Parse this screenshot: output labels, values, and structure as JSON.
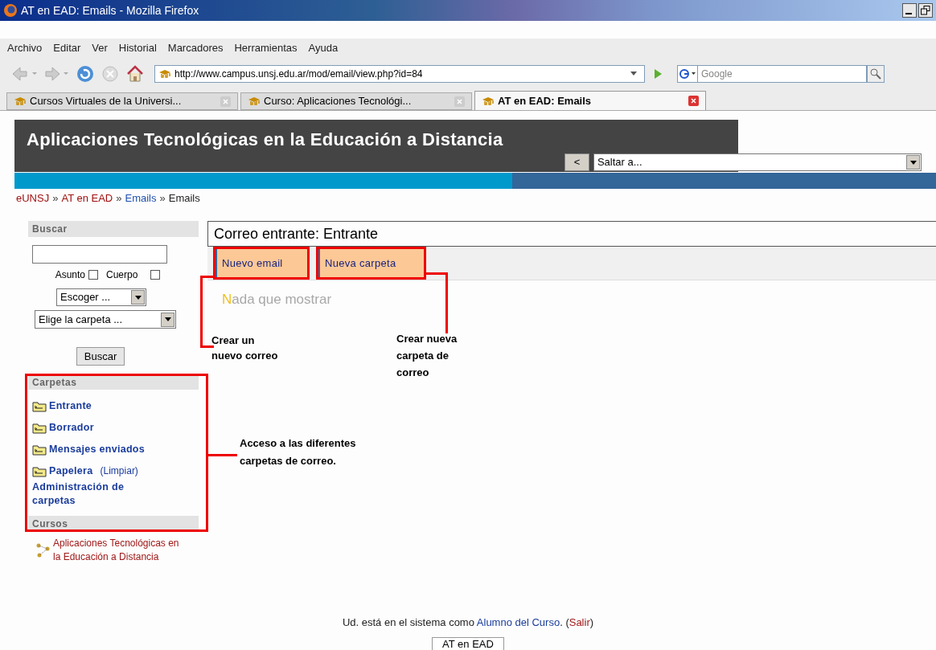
{
  "window": {
    "title": "AT en EAD: Emails - Mozilla Firefox"
  },
  "menu": [
    "Archivo",
    "Editar",
    "Ver",
    "Historial",
    "Marcadores",
    "Herramientas",
    "Ayuda"
  ],
  "toolbar": {
    "address": "http://www.campus.unsj.edu.ar/mod/email/view.php?id=84",
    "search_placeholder": "Google"
  },
  "tabs": [
    {
      "label": "Cursos Virtuales de la Universi...",
      "selected": false
    },
    {
      "label": "Curso: Aplicaciones Tecnológi...",
      "selected": false
    },
    {
      "label": "AT en EAD: Emails",
      "selected": true
    }
  ],
  "banner": {
    "title": "Aplicaciones Tecnológicas en la Educación a Distancia",
    "back": "<",
    "jump": "Saltar a..."
  },
  "breadcrumb": [
    {
      "text": "eUNSJ",
      "color": "#a01010"
    },
    {
      "separator": "»",
      "text": "AT en EAD",
      "color": "#a01010"
    },
    {
      "separator": "»",
      "text": "Emails",
      "color": "#2050b0"
    },
    {
      "separator": "»",
      "text": "Emails",
      "color": "#222222"
    }
  ],
  "search_block": {
    "title": "Buscar",
    "checkboxes": [
      {
        "label": "Asunto",
        "checked": false
      },
      {
        "label": "Cuerpo",
        "checked": false
      }
    ],
    "select_1": "Escoger ...",
    "select_2": "Elige la carpeta ...",
    "button": "Buscar"
  },
  "folders_block": {
    "title": "Carpetas",
    "folders": [
      {
        "name": "Entrante"
      },
      {
        "name": "Borrador"
      },
      {
        "name": "Mensajes enviados"
      },
      {
        "name": "Papelera",
        "action": "(Limpiar)"
      }
    ],
    "admin": "Administración de carpetas"
  },
  "courses_block": {
    "title": "Cursos",
    "course": "Aplicaciones Tecnológicas en la Educación a Distancia"
  },
  "main": {
    "heading": "Correo entrante: Entrante",
    "buttons": [
      "Nuevo email",
      "Nueva carpeta"
    ],
    "empty": "Nada que mostrar"
  },
  "annotations": [
    "Crear un nuevo correo",
    "Crear nueva carpeta de correo",
    "Acceso a las diferentes carpetas de correo."
  ],
  "footer": {
    "before": "Ud. está en el sistema como ",
    "user": "Alumno del Curso",
    "middle": ". (",
    "logout": "Salir",
    "after": ")",
    "button": "AT en EAD"
  }
}
